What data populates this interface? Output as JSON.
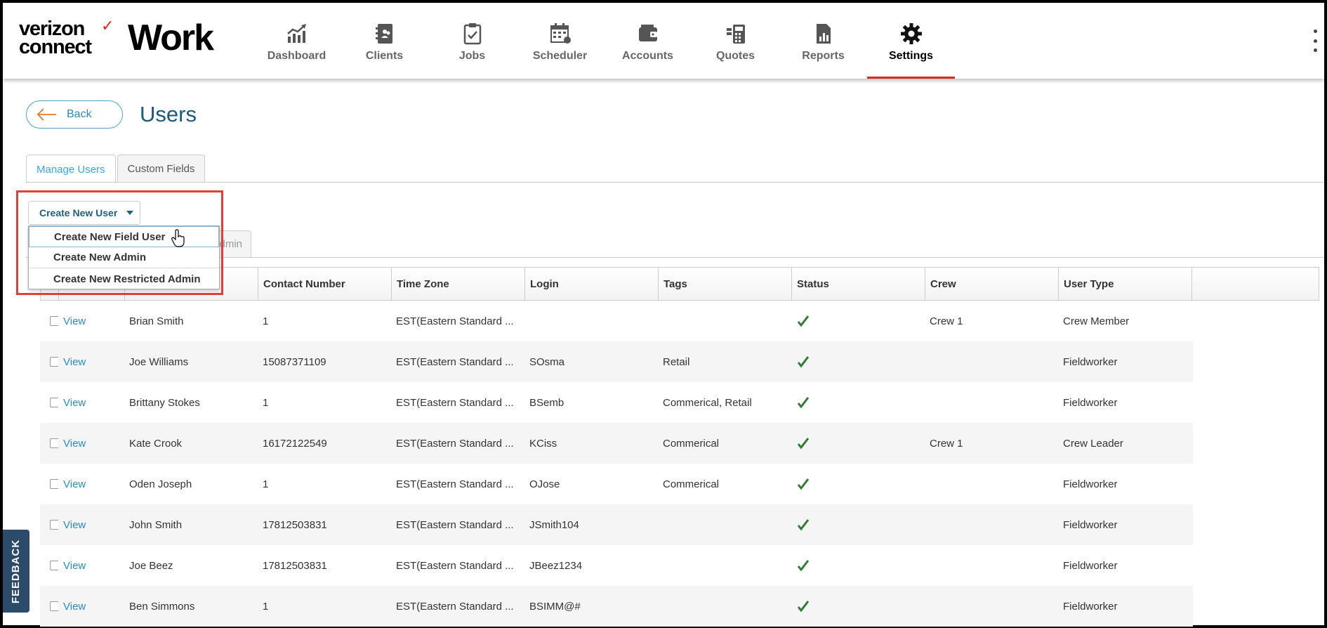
{
  "header": {
    "logo_line1": "verizon",
    "logo_line2": "connect",
    "logo_check": "✓",
    "product": "Work",
    "nav": [
      {
        "label": "Dashboard",
        "icon": "dashboard-icon"
      },
      {
        "label": "Clients",
        "icon": "clients-icon"
      },
      {
        "label": "Jobs",
        "icon": "jobs-icon"
      },
      {
        "label": "Scheduler",
        "icon": "scheduler-icon"
      },
      {
        "label": "Accounts",
        "icon": "accounts-icon"
      },
      {
        "label": "Quotes",
        "icon": "quotes-icon"
      },
      {
        "label": "Reports",
        "icon": "reports-icon"
      },
      {
        "label": "Settings",
        "icon": "gear-icon",
        "active": true
      }
    ]
  },
  "page": {
    "back_label": "Back",
    "title": "Users",
    "tabs": [
      "Manage Users",
      "Custom Fields"
    ],
    "subtab_partial": "dmin"
  },
  "create_menu": {
    "button_label": "Create New User",
    "items": [
      "Create New Field User",
      "Create New Admin",
      "Create New Restricted Admin"
    ]
  },
  "table": {
    "columns": [
      "",
      "",
      "",
      "Contact Number",
      "Time Zone",
      "Login",
      "Tags",
      "Status",
      "Crew",
      "User Type",
      ""
    ],
    "view_label": "View",
    "rows": [
      {
        "name": "Brian Smith",
        "contact": "1",
        "tz": "EST(Eastern Standard ...",
        "login": "",
        "tags": "",
        "crew": "Crew 1",
        "type": "Crew Member"
      },
      {
        "name": "Joe Williams",
        "contact": "15087371109",
        "tz": "EST(Eastern Standard ...",
        "login": "SOsma",
        "tags": "Retail",
        "crew": "",
        "type": "Fieldworker"
      },
      {
        "name": "Brittany Stokes",
        "contact": "1",
        "tz": "EST(Eastern Standard ...",
        "login": "BSemb",
        "tags": "Commerical, Retail",
        "crew": "",
        "type": "Fieldworker"
      },
      {
        "name": "Kate Crook",
        "contact": "16172122549",
        "tz": "EST(Eastern Standard ...",
        "login": "KCiss",
        "tags": "Commerical",
        "crew": "Crew 1",
        "type": "Crew Leader"
      },
      {
        "name": "Oden Joseph",
        "contact": "1",
        "tz": "EST(Eastern Standard ...",
        "login": "OJose",
        "tags": "Commerical",
        "crew": "",
        "type": "Fieldworker"
      },
      {
        "name": "John Smith",
        "contact": "17812503831",
        "tz": "EST(Eastern Standard ...",
        "login": "JSmith104",
        "tags": "",
        "crew": "",
        "type": "Fieldworker"
      },
      {
        "name": "Joe Beez",
        "contact": "17812503831",
        "tz": "EST(Eastern Standard ...",
        "login": "JBeez1234",
        "tags": "",
        "crew": "",
        "type": "Fieldworker"
      },
      {
        "name": "Ben Simmons",
        "contact": "1",
        "tz": "EST(Eastern Standard ...",
        "login": "BSIMM@#",
        "tags": "",
        "crew": "",
        "type": "Fieldworker"
      }
    ]
  },
  "feedback_label": "FEEDBACK",
  "colors": {
    "accent": "#2b8ab8",
    "active_tab": "#d52b1e",
    "status_check": "#2e7d32",
    "highlight": "#e0403a",
    "feedback_bg": "#2c4b6b"
  }
}
